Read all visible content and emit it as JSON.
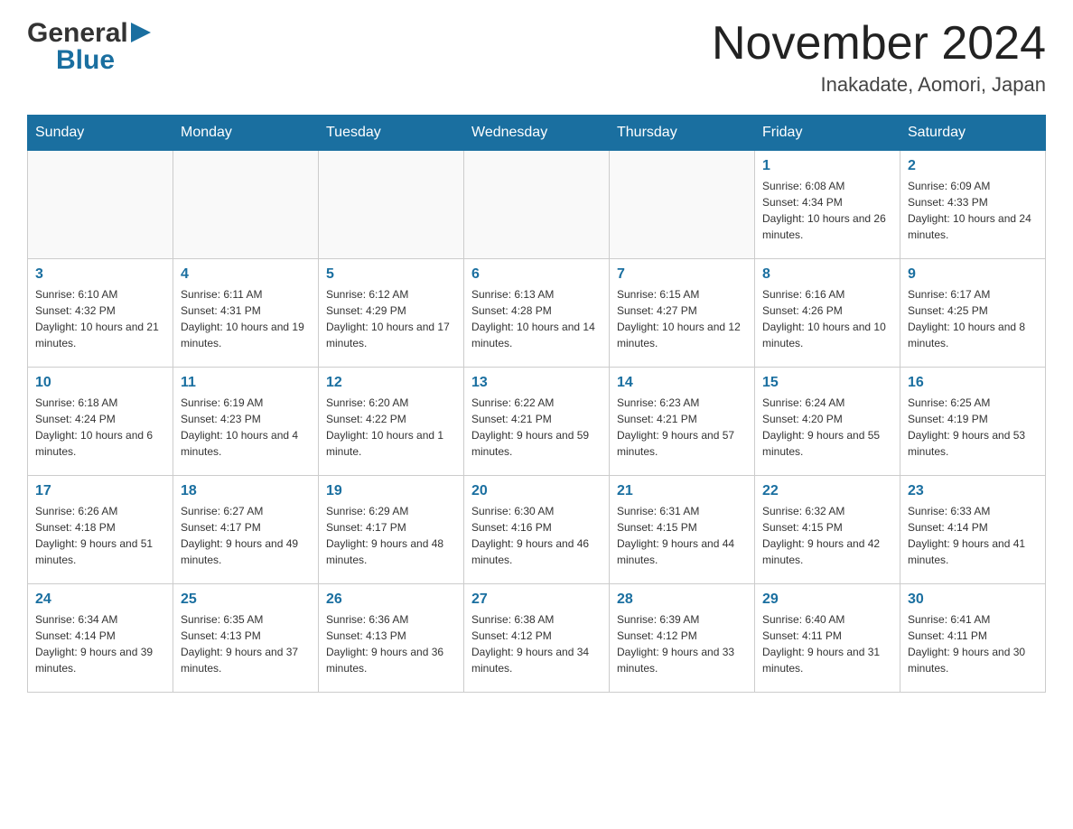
{
  "header": {
    "logo": {
      "general": "General",
      "blue": "Blue",
      "arrow_color": "#1a6fa0"
    },
    "title": "November 2024",
    "location": "Inakadate, Aomori, Japan"
  },
  "days_of_week": [
    "Sunday",
    "Monday",
    "Tuesday",
    "Wednesday",
    "Thursday",
    "Friday",
    "Saturday"
  ],
  "weeks": [
    {
      "cells": [
        {
          "day": "",
          "info": ""
        },
        {
          "day": "",
          "info": ""
        },
        {
          "day": "",
          "info": ""
        },
        {
          "day": "",
          "info": ""
        },
        {
          "day": "",
          "info": ""
        },
        {
          "day": "1",
          "info": "Sunrise: 6:08 AM\nSunset: 4:34 PM\nDaylight: 10 hours and 26 minutes."
        },
        {
          "day": "2",
          "info": "Sunrise: 6:09 AM\nSunset: 4:33 PM\nDaylight: 10 hours and 24 minutes."
        }
      ]
    },
    {
      "cells": [
        {
          "day": "3",
          "info": "Sunrise: 6:10 AM\nSunset: 4:32 PM\nDaylight: 10 hours and 21 minutes."
        },
        {
          "day": "4",
          "info": "Sunrise: 6:11 AM\nSunset: 4:31 PM\nDaylight: 10 hours and 19 minutes."
        },
        {
          "day": "5",
          "info": "Sunrise: 6:12 AM\nSunset: 4:29 PM\nDaylight: 10 hours and 17 minutes."
        },
        {
          "day": "6",
          "info": "Sunrise: 6:13 AM\nSunset: 4:28 PM\nDaylight: 10 hours and 14 minutes."
        },
        {
          "day": "7",
          "info": "Sunrise: 6:15 AM\nSunset: 4:27 PM\nDaylight: 10 hours and 12 minutes."
        },
        {
          "day": "8",
          "info": "Sunrise: 6:16 AM\nSunset: 4:26 PM\nDaylight: 10 hours and 10 minutes."
        },
        {
          "day": "9",
          "info": "Sunrise: 6:17 AM\nSunset: 4:25 PM\nDaylight: 10 hours and 8 minutes."
        }
      ]
    },
    {
      "cells": [
        {
          "day": "10",
          "info": "Sunrise: 6:18 AM\nSunset: 4:24 PM\nDaylight: 10 hours and 6 minutes."
        },
        {
          "day": "11",
          "info": "Sunrise: 6:19 AM\nSunset: 4:23 PM\nDaylight: 10 hours and 4 minutes."
        },
        {
          "day": "12",
          "info": "Sunrise: 6:20 AM\nSunset: 4:22 PM\nDaylight: 10 hours and 1 minute."
        },
        {
          "day": "13",
          "info": "Sunrise: 6:22 AM\nSunset: 4:21 PM\nDaylight: 9 hours and 59 minutes."
        },
        {
          "day": "14",
          "info": "Sunrise: 6:23 AM\nSunset: 4:21 PM\nDaylight: 9 hours and 57 minutes."
        },
        {
          "day": "15",
          "info": "Sunrise: 6:24 AM\nSunset: 4:20 PM\nDaylight: 9 hours and 55 minutes."
        },
        {
          "day": "16",
          "info": "Sunrise: 6:25 AM\nSunset: 4:19 PM\nDaylight: 9 hours and 53 minutes."
        }
      ]
    },
    {
      "cells": [
        {
          "day": "17",
          "info": "Sunrise: 6:26 AM\nSunset: 4:18 PM\nDaylight: 9 hours and 51 minutes."
        },
        {
          "day": "18",
          "info": "Sunrise: 6:27 AM\nSunset: 4:17 PM\nDaylight: 9 hours and 49 minutes."
        },
        {
          "day": "19",
          "info": "Sunrise: 6:29 AM\nSunset: 4:17 PM\nDaylight: 9 hours and 48 minutes."
        },
        {
          "day": "20",
          "info": "Sunrise: 6:30 AM\nSunset: 4:16 PM\nDaylight: 9 hours and 46 minutes."
        },
        {
          "day": "21",
          "info": "Sunrise: 6:31 AM\nSunset: 4:15 PM\nDaylight: 9 hours and 44 minutes."
        },
        {
          "day": "22",
          "info": "Sunrise: 6:32 AM\nSunset: 4:15 PM\nDaylight: 9 hours and 42 minutes."
        },
        {
          "day": "23",
          "info": "Sunrise: 6:33 AM\nSunset: 4:14 PM\nDaylight: 9 hours and 41 minutes."
        }
      ]
    },
    {
      "cells": [
        {
          "day": "24",
          "info": "Sunrise: 6:34 AM\nSunset: 4:14 PM\nDaylight: 9 hours and 39 minutes."
        },
        {
          "day": "25",
          "info": "Sunrise: 6:35 AM\nSunset: 4:13 PM\nDaylight: 9 hours and 37 minutes."
        },
        {
          "day": "26",
          "info": "Sunrise: 6:36 AM\nSunset: 4:13 PM\nDaylight: 9 hours and 36 minutes."
        },
        {
          "day": "27",
          "info": "Sunrise: 6:38 AM\nSunset: 4:12 PM\nDaylight: 9 hours and 34 minutes."
        },
        {
          "day": "28",
          "info": "Sunrise: 6:39 AM\nSunset: 4:12 PM\nDaylight: 9 hours and 33 minutes."
        },
        {
          "day": "29",
          "info": "Sunrise: 6:40 AM\nSunset: 4:11 PM\nDaylight: 9 hours and 31 minutes."
        },
        {
          "day": "30",
          "info": "Sunrise: 6:41 AM\nSunset: 4:11 PM\nDaylight: 9 hours and 30 minutes."
        }
      ]
    }
  ]
}
